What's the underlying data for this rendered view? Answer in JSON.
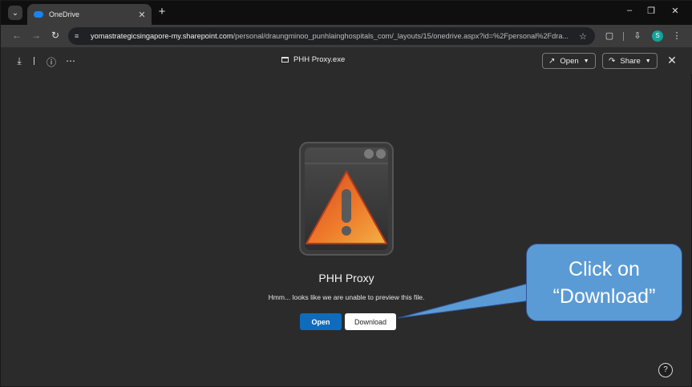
{
  "browser": {
    "tab_title": "OneDrive",
    "tab_close": "✕",
    "new_tab": "+",
    "url_host": "yomastrategicsingapore-my.sharepoint.com",
    "url_path": "/personal/draungminoo_punhlainghospitals_com/_layouts/15/onedrive.aspx?id=%2Fpersonal%2Fdra...",
    "avatar_letter": "S",
    "icons": [
      "tab-search-icon",
      "onedrive-cloud-icon",
      "back-icon",
      "forward-icon",
      "reload-icon",
      "site-info-icon",
      "star-icon",
      "extensions-icon",
      "downloads-icon",
      "profile-avatar",
      "menu-icon",
      "minimize-icon",
      "restore-icon",
      "close-window-icon"
    ]
  },
  "viewer": {
    "filename": "PHH Proxy.exe",
    "open_label": "Open",
    "share_label": "Share",
    "icons": [
      "download-icon",
      "info-icon",
      "more-icon",
      "open-external-icon",
      "share-icon",
      "close-icon",
      "help-icon"
    ]
  },
  "preview": {
    "title": "PHH Proxy",
    "message": "Hmm... looks like we are unable to preview this file.",
    "open_button": "Open",
    "download_button": "Download"
  },
  "callout": {
    "line1": "Click on",
    "line2": "“Download”",
    "color": "#5b9bd5"
  },
  "help": "?"
}
